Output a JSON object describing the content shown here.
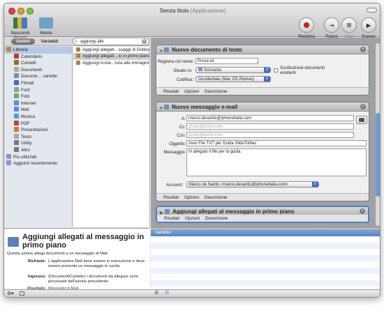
{
  "window": {
    "title": "Senza titolo",
    "subtitle": "(Applicazione)"
  },
  "toolbar": {
    "hide_library": "Nascondi libreria",
    "media": "Media",
    "record": "Registra",
    "step": "Passo",
    "stop": "Stop",
    "run": "Esegui"
  },
  "tabs": {
    "actions": "Azioni",
    "variables": "Variabili"
  },
  "search": {
    "value": "aggiungi alle"
  },
  "library": [
    "Libreria",
    "Calendario",
    "Contatti",
    "Documenti",
    "Docume… cartelle",
    "Filmati",
    "Font",
    "Foto",
    "Internet",
    "Mail",
    "Musica",
    "PDF",
    "Presentazioni",
    "Testo",
    "Utility",
    "Altro",
    "Più utilizzati",
    "Aggiunti recentemente"
  ],
  "actions": [
    "Aggiungi allegati…ssaggi di Outlook",
    "Aggiungi allegati…io in primo piano",
    "Aggiungi icona…tura alle immagini"
  ],
  "description": {
    "title": "Aggiungi allegati al messaggio in primo piano",
    "text": "Questa azione allega documenti a un messaggio di Mail.",
    "requires_label": "Richiede:",
    "requires": "L'applicazione Mail deve essere in esecuzione e deve essere presente un messaggio in uscita.",
    "input_label": "Ingresso:",
    "input": "(Documenti/Cartelle) I documenti da allegare sono processati dall'azione precedente.",
    "result_label": "Risultato:",
    "result": "Messaggi di Mail"
  },
  "card1": {
    "title": "Nuovo documento di testo",
    "save_label": "Registra col nome:",
    "save_value": "Prova.txt",
    "where_label": "Situato in:",
    "where_value": "Scrivania",
    "replace_label": "Sostituzione documenti esistenti",
    "encoding_label": "Codifica:",
    "encoding_value": "Occidentale (Mac OS Roman)",
    "tabs": [
      "Risultati",
      "Opzioni",
      "Descrizione"
    ]
  },
  "card2": {
    "title": "Nuovo messaggio e-mail",
    "to_label": "A:",
    "to_value": "marco.desantis@iphoneitalia.com",
    "cc_label": "Cc:",
    "cc_placeholder": "group@acme.com",
    "bcc_label": "Ccn:",
    "bcc_placeholder": "group@acme.com",
    "subject_label": "Oggetto:",
    "subject_value": "Invio File TXT per Guida SlideToMac",
    "message_label": "Messaggio:",
    "message_value": "In allegato il file per la guida.",
    "account_label": "Account:",
    "account_value": "Marco de Santis <marco.desantis@iphoneitalia.com>",
    "tabs": [
      "Risultati",
      "Opzioni",
      "Descrizione"
    ]
  },
  "card3": {
    "title": "Aggiungi allegati al messaggio in primo piano",
    "tabs": [
      "Risultati",
      "Opzioni",
      "Descrizione"
    ]
  },
  "variables": {
    "header": "Variabile"
  },
  "colors": {
    "accent": "#3d71c8",
    "selected": "#b6c9e6"
  }
}
